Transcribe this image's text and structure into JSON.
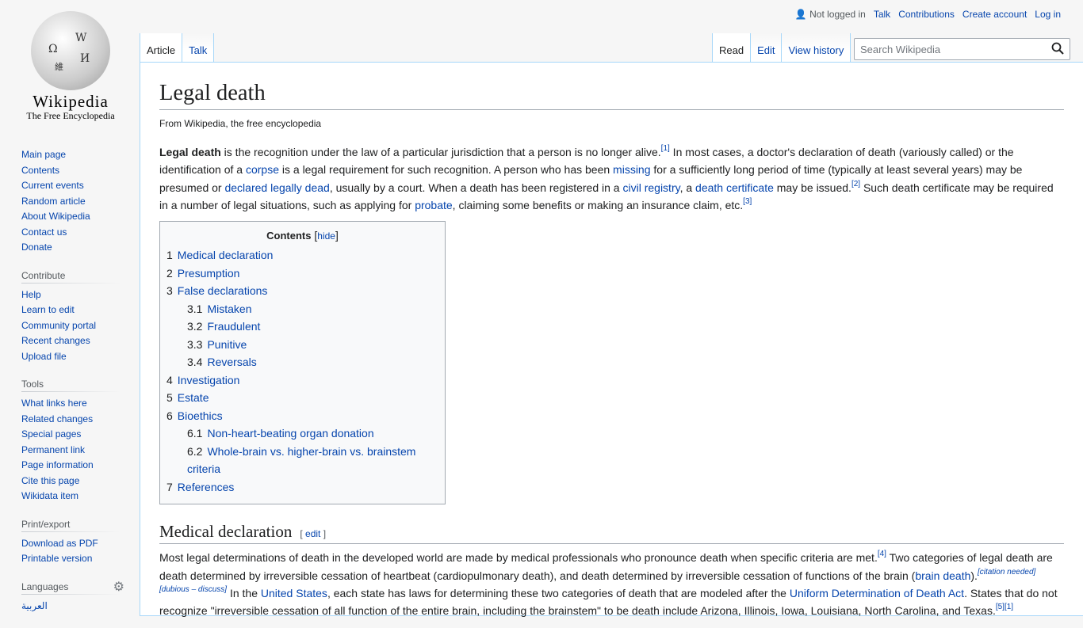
{
  "logo": {
    "wordmark": "Wikipedia",
    "tagline": "The Free Encyclopedia"
  },
  "personal": {
    "status": "Not logged in",
    "links": [
      "Talk",
      "Contributions",
      "Create account",
      "Log in"
    ]
  },
  "tabs": {
    "left": [
      "Article",
      "Talk"
    ],
    "right": [
      "Read",
      "Edit",
      "View history"
    ],
    "search_placeholder": "Search Wikipedia"
  },
  "sidebar": {
    "nav": [
      "Main page",
      "Contents",
      "Current events",
      "Random article",
      "About Wikipedia",
      "Contact us",
      "Donate"
    ],
    "contribute": {
      "title": "Contribute",
      "items": [
        "Help",
        "Learn to edit",
        "Community portal",
        "Recent changes",
        "Upload file"
      ]
    },
    "tools": {
      "title": "Tools",
      "items": [
        "What links here",
        "Related changes",
        "Special pages",
        "Permanent link",
        "Page information",
        "Cite this page",
        "Wikidata item"
      ]
    },
    "print": {
      "title": "Print/export",
      "items": [
        "Download as PDF",
        "Printable version"
      ]
    },
    "languages": {
      "title": "Languages",
      "items": [
        "العربية"
      ]
    }
  },
  "article": {
    "title": "Legal death",
    "subtitle": "From Wikipedia, the free encyclopedia",
    "intro": [
      {
        "t": "Legal death",
        "b": true
      },
      {
        "t": " is the recognition under the law of a particular jurisdiction that a person is no longer alive."
      },
      {
        "t": "[1]",
        "sup": true
      },
      {
        "t": " In most cases, a doctor's declaration of death (variously called) or the identification of a "
      },
      {
        "t": "corpse",
        "link": true
      },
      {
        "t": " is a legal requirement for such recognition. A person who has been "
      },
      {
        "t": "missing",
        "link": true
      },
      {
        "t": " for a sufficiently long period of time (typically at least several years) may be presumed or "
      },
      {
        "t": "declared legally dead",
        "link": true
      },
      {
        "t": ", usually by a court. When a death has been registered in a "
      },
      {
        "t": "civil registry",
        "link": true
      },
      {
        "t": ", a "
      },
      {
        "t": "death certificate",
        "link": true
      },
      {
        "t": " may be issued."
      },
      {
        "t": "[2]",
        "sup": true
      },
      {
        "t": " Such death certificate may be required in a number of legal situations, such as applying for "
      },
      {
        "t": "probate",
        "link": true
      },
      {
        "t": ", claiming some benefits or making an insurance claim, etc."
      },
      {
        "t": "[3]",
        "sup": true
      }
    ],
    "toc": {
      "title": "Contents",
      "hide": "hide",
      "items": [
        {
          "n": "1",
          "t": "Medical declaration",
          "l": 1
        },
        {
          "n": "2",
          "t": "Presumption",
          "l": 1
        },
        {
          "n": "3",
          "t": "False declarations",
          "l": 1
        },
        {
          "n": "3.1",
          "t": "Mistaken",
          "l": 2
        },
        {
          "n": "3.2",
          "t": "Fraudulent",
          "l": 2
        },
        {
          "n": "3.3",
          "t": "Punitive",
          "l": 2
        },
        {
          "n": "3.4",
          "t": "Reversals",
          "l": 2
        },
        {
          "n": "4",
          "t": "Investigation",
          "l": 1
        },
        {
          "n": "5",
          "t": "Estate",
          "l": 1
        },
        {
          "n": "6",
          "t": "Bioethics",
          "l": 1
        },
        {
          "n": "6.1",
          "t": "Non-heart-beating organ donation",
          "l": 2
        },
        {
          "n": "6.2",
          "t": "Whole-brain vs. higher-brain vs. brainstem criteria",
          "l": 2
        },
        {
          "n": "7",
          "t": "References",
          "l": 1
        }
      ]
    },
    "section1": {
      "title": "Medical declaration",
      "edit": "edit",
      "para": [
        {
          "t": "Most legal determinations of death in the developed world are made by medical professionals who pronounce death when specific criteria are met."
        },
        {
          "t": "[4]",
          "sup": true
        },
        {
          "t": " Two categories of legal death are death determined by irreversible cessation of heartbeat (cardiopulmonary death), and death determined by irreversible cessation of functions of the brain ("
        },
        {
          "t": "brain death",
          "link": true
        },
        {
          "t": ")."
        },
        {
          "t": "[citation needed]",
          "sup": true,
          "cit": true
        },
        {
          "t": "[dubious – discuss]",
          "sup": true,
          "cit": true
        },
        {
          "t": " In the "
        },
        {
          "t": "United States",
          "link": true
        },
        {
          "t": ", each state has laws for determining these two categories of death that are modeled after the "
        },
        {
          "t": "Uniform Determination of Death Act",
          "link": true
        },
        {
          "t": ". States that do not recognize \"irreversible cessation of all function of the entire brain, including the brainstem\" to be death include Arizona, Illinois, Iowa, Louisiana, North Carolina, and Texas."
        },
        {
          "t": "[5][1]",
          "sup": true
        }
      ]
    }
  },
  "colors": {
    "link": "#0645ad",
    "border": "#a7d7f9"
  }
}
